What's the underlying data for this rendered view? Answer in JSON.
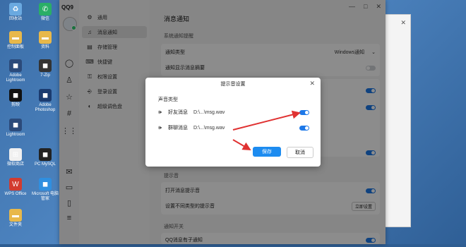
{
  "desktop": {
    "icons": [
      {
        "label": "回收站",
        "icon": "recycle-icon",
        "color": "#6aa9e0"
      },
      {
        "label": "微信",
        "icon": "wechat-icon",
        "color": "#2aae67"
      },
      {
        "label": "控制面板",
        "icon": "folder-icon",
        "color": "#e8b84a"
      },
      {
        "label": "资料",
        "icon": "folder-icon",
        "color": "#e8b84a"
      },
      {
        "label": "Adobe Lightroom",
        "icon": "app-icon",
        "color": "#2b4a7a"
      },
      {
        "label": "7-Zip",
        "icon": "app-icon",
        "color": "#333333"
      },
      {
        "label": "剪映",
        "icon": "app-icon",
        "color": "#111111"
      },
      {
        "label": "Adobe Photoshop",
        "icon": "app-icon",
        "color": "#1b3b6f"
      },
      {
        "label": "Lightroom",
        "icon": "app-icon",
        "color": "#2b4a7a"
      },
      {
        "label": "微软商店",
        "icon": "store-icon",
        "color": "#f0f0f0"
      },
      {
        "label": "PC MySQL",
        "icon": "app-icon",
        "color": "#222222"
      },
      {
        "label": "WPS Office",
        "icon": "wps-icon",
        "color": "#d23b2f"
      },
      {
        "label": "Microsoft 电脑管家",
        "icon": "app-icon",
        "color": "#2f8fe0"
      },
      {
        "label": "文件夹",
        "icon": "folder-icon",
        "color": "#e8b84a"
      }
    ]
  },
  "qq": {
    "logo": "QQ9",
    "side_icons": [
      "chat-icon",
      "contacts-icon",
      "star-icon",
      "hash-icon",
      "grid-icon",
      "mail-icon",
      "folder-icon",
      "bookmark-icon",
      "menu-icon"
    ],
    "nav": [
      {
        "label": "通用",
        "icon": "gear-icon"
      },
      {
        "label": "消息通知",
        "icon": "bell-icon",
        "active": true
      },
      {
        "label": "存储管理",
        "icon": "storage-icon"
      },
      {
        "label": "快捷键",
        "icon": "keyboard-icon"
      },
      {
        "label": "权限设置",
        "icon": "lock-icon"
      },
      {
        "label": "登录设置",
        "icon": "login-icon"
      },
      {
        "label": "超级调色盘",
        "icon": "palette-icon"
      }
    ],
    "main": {
      "title": "消息通知",
      "system_notice_label": "系统通知提醒",
      "notice_type_label": "通知类型",
      "notice_type_value": "Windows通知",
      "show_summary_label": "通知显示消息摘要",
      "prompt_sound_label": "提示音",
      "open_sound_label": "打开消息提示音",
      "set_sound_label": "设置不同类型的提示音",
      "set_sound_button": "立即设置",
      "notice_switch_label": "通知开关",
      "qq_member_label": "QQ消息有子通知"
    }
  },
  "dialog": {
    "title": "提示音设置",
    "section": "声音类型",
    "rows": [
      {
        "name": "好友消息",
        "path": "D:\\...\\msg.wav"
      },
      {
        "name": "群聊消息",
        "path": "D:\\...\\msg.wav"
      }
    ],
    "save": "保存",
    "cancel": "取消"
  },
  "colors": {
    "accent": "#1d8cf0",
    "toggle_on": "#1d78e8",
    "arrow": "#e03232"
  }
}
